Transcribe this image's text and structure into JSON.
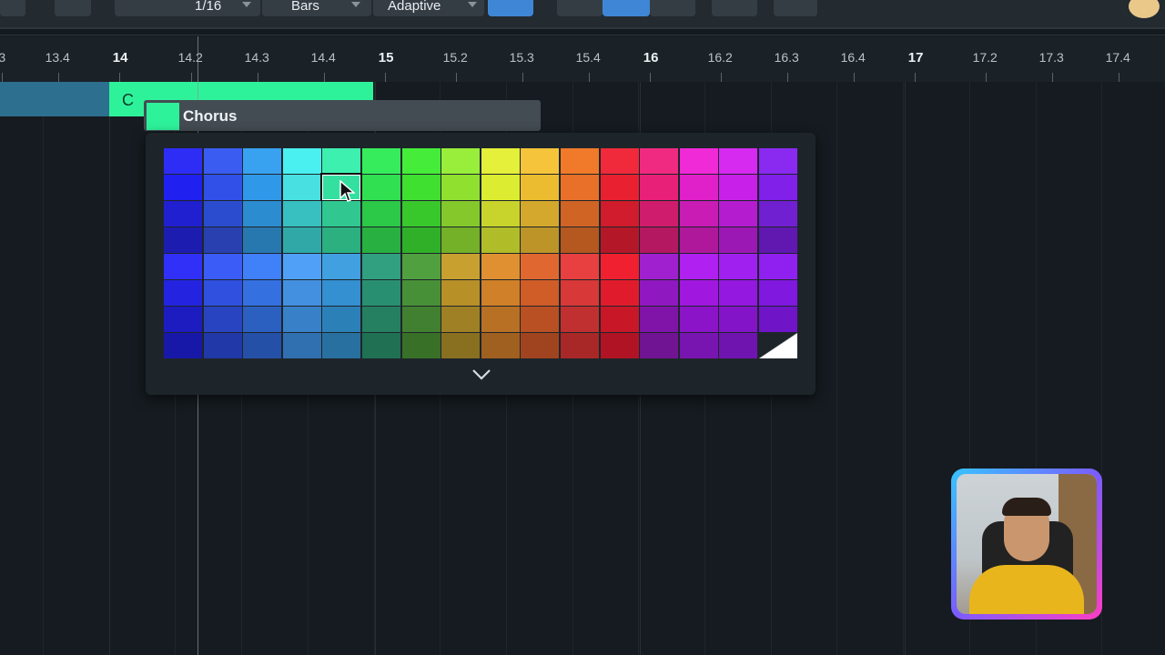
{
  "toolbar": {
    "quantize_value": "1/16",
    "timebase": "Bars",
    "snap_mode": "Adaptive"
  },
  "ruler": {
    "ticks": [
      {
        "label": "3",
        "major": false
      },
      {
        "label": "13.4",
        "major": false
      },
      {
        "label": "14",
        "major": true
      },
      {
        "label": "14.2",
        "major": false
      },
      {
        "label": "14.3",
        "major": false
      },
      {
        "label": "14.4",
        "major": false
      },
      {
        "label": "15",
        "major": true
      },
      {
        "label": "15.2",
        "major": false
      },
      {
        "label": "15.3",
        "major": false
      },
      {
        "label": "15.4",
        "major": false
      },
      {
        "label": "16",
        "major": true
      },
      {
        "label": "16.2",
        "major": false
      },
      {
        "label": "16.3",
        "major": false
      },
      {
        "label": "16.4",
        "major": false
      },
      {
        "label": "17",
        "major": true
      },
      {
        "label": "17.2",
        "major": false
      },
      {
        "label": "17.3",
        "major": false
      },
      {
        "label": "17.4",
        "major": false
      }
    ]
  },
  "part": {
    "label": "C",
    "color": "#2ef29a"
  },
  "name_field": {
    "value": "Chorus",
    "color": "#2ef29a"
  },
  "palette": {
    "selected": {
      "row": 1,
      "col": 4
    },
    "rows": [
      [
        "#2d2df5",
        "#3a5cf0",
        "#39a2f0",
        "#4af0f0",
        "#3ef0b0",
        "#36ec5c",
        "#46ec3a",
        "#98ee3a",
        "#e4f03a",
        "#f5c43a",
        "#f07a2a",
        "#f02a3a",
        "#f02a80",
        "#ef2ad6",
        "#d62af0",
        "#8a2af0"
      ],
      [
        "#2020f0",
        "#3050e8",
        "#3098e8",
        "#48e0e0",
        "#34e0a0",
        "#30e050",
        "#40e030",
        "#90e030",
        "#dcec30",
        "#ecbc30",
        "#e87028",
        "#e82030",
        "#e82078",
        "#e020c8",
        "#c820e8",
        "#8020e8"
      ],
      [
        "#2020d0",
        "#2c4cd0",
        "#2c8cd0",
        "#38c0c0",
        "#30c890",
        "#2cc848",
        "#38c82c",
        "#84c82c",
        "#c8d42c",
        "#d4a82c",
        "#d06424",
        "#d01c2c",
        "#d01c6c",
        "#c81cb4",
        "#b41cd0",
        "#7020d0"
      ],
      [
        "#1c1cb0",
        "#2840b0",
        "#2878b0",
        "#30a8a8",
        "#2cb080",
        "#28b040",
        "#30b028",
        "#74b028",
        "#b0bc28",
        "#bc9428",
        "#b45820",
        "#b41828",
        "#b41860",
        "#b0189c",
        "#9c18b4",
        "#6018b0"
      ],
      [
        "#3030f8",
        "#3c5cf8",
        "#4080f8",
        "#50a0f8",
        "#40a0e0",
        "#30a080",
        "#50a040",
        "#c8a030",
        "#e09030",
        "#e06830",
        "#e84040",
        "#f02030",
        "#a020d0",
        "#b020f0",
        "#a020f0",
        "#9020f0"
      ],
      [
        "#2424e0",
        "#3050e0",
        "#3470e0",
        "#4490e0",
        "#3490d0",
        "#289070",
        "#489038",
        "#b89028",
        "#d08028",
        "#d05c28",
        "#d83838",
        "#e01c2c",
        "#9018c0",
        "#a018e0",
        "#9418e0",
        "#8018e0"
      ],
      [
        "#1c1cc0",
        "#2844c0",
        "#2c60c0",
        "#3880c8",
        "#2c80b8",
        "#248060",
        "#408030",
        "#a08024",
        "#b87024",
        "#b85024",
        "#c03030",
        "#c81828",
        "#8014a8",
        "#8c14c8",
        "#8414c8",
        "#7014c8"
      ],
      [
        "#1818a8",
        "#2038a8",
        "#2450a8",
        "#3070b0",
        "#2870a0",
        "#207054",
        "#387028",
        "#887020",
        "#a06020",
        "#a04420",
        "#a82828",
        "#b01424",
        "#701494",
        "#7814b0",
        "#7014b0",
        null
      ]
    ]
  }
}
